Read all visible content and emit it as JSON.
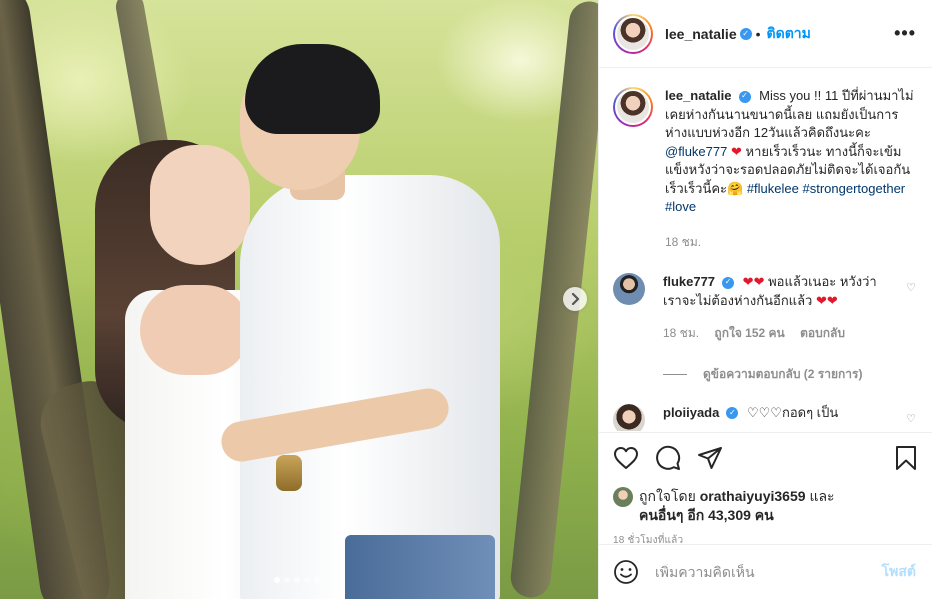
{
  "photo": {
    "alt_subject": "couple-photo",
    "carousel_dots": 5,
    "active_dot": 0,
    "next_icon": "chevron-right-icon"
  },
  "header": {
    "username": "lee_natalie",
    "bullet": "•",
    "follow_label": "ติดตาม",
    "more_icon": "more-options-icon",
    "more_glyph": "•••"
  },
  "caption": {
    "username": "lee_natalie",
    "text_1": "Miss you !! 11 ปีที่ผ่านมาไม่เคยห่างกันนานขนาดนี้เลย แถมยังเป็นการห่างแบบห่วงอีก 12วันแล้วคิดถึงนะคะ",
    "mention": "@fluke777",
    "heart": "❤",
    "text_2": "หายเร็วเร็วนะ ทางนี้ก็จะเข้มแข็งหวังว่าจะรอดปลอดภัยไม่ติดจะได้เจอกันเร็วเร็วนี้คะ🤗",
    "hashtag_1": "#flukelee",
    "hashtag_2": "#strongertogether",
    "hashtag_3": "#love",
    "time": "18 ชม."
  },
  "comments": [
    {
      "username": "fluke777",
      "hearts_1": "❤❤",
      "text": "พอแล้วเนอะ หวังว่าเราจะไม่ต้องห่างกันอีกแล้ว",
      "hearts_2": "❤❤",
      "time": "18 ชม.",
      "likes": "ถูกใจ 152 คน",
      "reply": "ตอบกลับ",
      "view_replies": "ดูข้อความตอบกลับ (2 รายการ)"
    },
    {
      "username": "ploiiyada",
      "text": "♡♡♡กอดๆ เป็น"
    }
  ],
  "actions": {
    "like_icon": "heart-icon",
    "comment_icon": "comment-icon",
    "share_icon": "share-icon",
    "save_icon": "bookmark-icon",
    "liked_by_prefix": "ถูกใจโดย",
    "liked_by_user": "orathaiyuyi3659",
    "liked_by_and": "และ",
    "others": "คนอื่นๆ อีก 43,309 คน",
    "time": "18 ชั่วโมงที่แล้ว"
  },
  "add_comment": {
    "emoji_icon": "smiley-icon",
    "placeholder": "เพิ่มความคิดเห็น",
    "post_label": "โพสต์"
  }
}
